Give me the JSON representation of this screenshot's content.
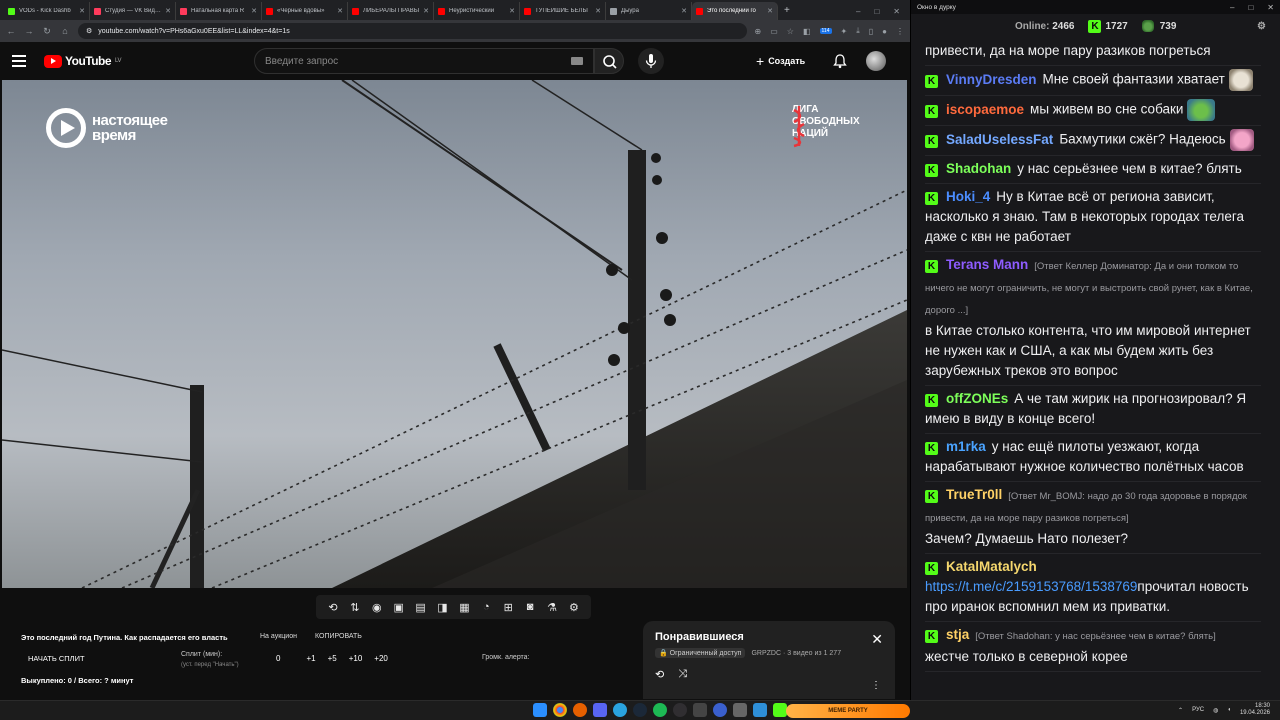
{
  "browser": {
    "tabs": [
      {
        "label": "VODs - Kick Dashb",
        "color": "#53fc18"
      },
      {
        "label": "Студия — VK Видео",
        "color": "#ff3b5c"
      },
      {
        "label": "Натальная карта R",
        "color": "#ff3b5c"
      },
      {
        "label": "«Черные вдовы»",
        "color": "#ff0000"
      },
      {
        "label": "ЛИБЕРАЛЫ ПРАВЫ",
        "color": "#ff0000"
      },
      {
        "label": "Неуристический",
        "color": "#ff0000"
      },
      {
        "label": "ТУПЕЙШИЕ БЕЛЫ",
        "color": "#ff0000"
      },
      {
        "label": "Дыура",
        "color": "#9aa0a6"
      },
      {
        "label": "Это последний го",
        "color": "#ff0000"
      }
    ],
    "url": "youtube.com/watch?v=PHs6aGxu0EE&list=LL&index=4&t=1s",
    "ext_badge": "114"
  },
  "youtube": {
    "logo": "YouTube",
    "region": "LV",
    "search_placeholder": "Введите запрос",
    "create_label": "Создать"
  },
  "video": {
    "brand": "НАСТОЯЩЕЕ ВРЕМЯ",
    "brand_line1": "настоящее",
    "brand_line2": "время",
    "liga_line1": "ЛИГА",
    "liga_line2": "СВОБОДНЫХ",
    "liga_line3": "НАЦИЙ"
  },
  "panel": {
    "title": "Это последний год Путина. Как распадается его власть",
    "auction": "На аукцион",
    "copy": "КОПИРОВАТЬ",
    "start_split": "НАЧАТЬ СПЛИТ",
    "split_label": "Сплит (мин):",
    "split_hint": "(уст. перед \"Начать\")",
    "split_value": "0",
    "steps": [
      "+1",
      "+5",
      "+10",
      "+20"
    ],
    "alert_label": "Громк. алерта:",
    "bought": "Выкуплено: 0 / Всего: ? минут"
  },
  "liked": {
    "title": "Понравившиеся",
    "access": "Ограниченный доступ",
    "meta": "GRPZDC · 3 видео из 1 277"
  },
  "chat": {
    "window_title": "Окно в дурку",
    "online_label": "Online:",
    "online_value": "2466",
    "kick_count": "1727",
    "other_count": "739",
    "top_fragment": "привести, да на море пару разиков погреться",
    "messages": [
      {
        "name": "VinnyDresden",
        "color": "#5b7cf5",
        "reply": "",
        "text": "Мне своей фантазии хватает",
        "emote_after": "dog"
      },
      {
        "name": "iscopaemoe",
        "color": "#ff6a3d",
        "reply": "",
        "text": "мы живем во сне собаки",
        "emote_after": "pepe"
      },
      {
        "name": "SaladUselessFat",
        "color": "#74a8ff",
        "reply": "",
        "text": "Бахмутики сжёг? Надеюсь",
        "emote_after": "pink"
      },
      {
        "name": "Shadohan",
        "color": "#7dff5a",
        "reply": "",
        "text": "у нас серьёзнее чем в китае? блять",
        "emote_after": ""
      },
      {
        "name": "Hoki_4",
        "color": "#4b8dff",
        "reply": "",
        "text": "Ну в Китае всё от региона зависит, насколько я знаю. Там в некоторых городах телега даже с квн не работает",
        "emote_after": ""
      },
      {
        "name": "Terans Mann",
        "color": "#8e5cff",
        "reply": "[Ответ Келлер Доминатор: Да и они толком то ничего не могут ограничить, не могут и выстроить свой рунет, как в Китае, дорого ...]",
        "text": "в Китае столько контента, что им мировой интернет не нужен как и США, а как мы будем жить без зарубежных треков это вопрос",
        "emote_after": ""
      },
      {
        "name": "offZONEs",
        "color": "#7dff5a",
        "reply": "",
        "text": "А че там жирик на прогнозировал? Я имею в виду в конце всего!",
        "emote_after": ""
      },
      {
        "name": "m1rka",
        "color": "#4aa3ff",
        "reply": "",
        "text": "у нас ещё пилоты уезжают, когда нарабатывают нужное количество полётных часов",
        "emote_after": ""
      },
      {
        "name": "TrueTr0ll",
        "color": "#ffd166",
        "reply": "[Ответ Mr_BOMJ: надо до 30 года здоровье в порядок привести, да на море пару разиков погреться]",
        "text": "Зачем? Думаешь Нато полезет?",
        "emote_after": ""
      },
      {
        "name": "KatalMatalych",
        "color": "#f5d76e",
        "reply": "",
        "link": "https://t.me/c/2159153768/1538769",
        "text": "прочитал новость про иранок вспомнил мем из приватки.",
        "emote_after": ""
      },
      {
        "name": "stja",
        "color": "#ffd166",
        "reply": "[Ответ Shadohan: у нас серьёзнее чем в китае? блять]",
        "text": "жестче только в северной корее",
        "emote_after": ""
      }
    ]
  },
  "taskbar": {
    "meme_label": "MEME PARTY",
    "lang": "РУС",
    "time": "18:30",
    "date": "19.04.2026"
  }
}
